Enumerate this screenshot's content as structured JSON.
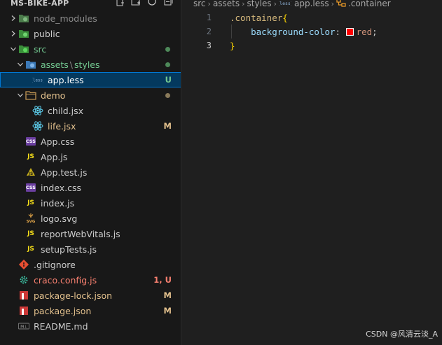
{
  "explorer": {
    "project_title": "MS-BIKE-APP",
    "actions": [
      "new-file-icon",
      "new-folder-icon",
      "refresh-icon",
      "collapse-all-icon"
    ],
    "items": [
      {
        "id": "node_modules",
        "label": "node_modules",
        "icon": "folder-node-icon",
        "depth": 0,
        "chevron": "right",
        "dimmed": true
      },
      {
        "id": "public",
        "label": "public",
        "icon": "folder-public-icon",
        "depth": 0,
        "chevron": "right"
      },
      {
        "id": "src",
        "label": "src",
        "icon": "folder-src-icon",
        "depth": 0,
        "chevron": "down",
        "labelColor": "#73c991",
        "dot": "#4e8a5a"
      },
      {
        "id": "assets",
        "label": "assets",
        "label_sep": "\\",
        "label_extra": "styles",
        "icon": "folder-assets-icon",
        "depth": 1,
        "chevron": "down",
        "labelColor": "#73c991",
        "dot": "#4e8a5a"
      },
      {
        "id": "app-less",
        "label": "app.less",
        "icon": "less-file-icon",
        "depth": 2,
        "selected": true,
        "badge": "U",
        "badgeColor": "#73c991",
        "labelColor": "#ffffff"
      },
      {
        "id": "demo",
        "label": "demo",
        "icon": "folder-icon",
        "depth": 1,
        "chevron": "down",
        "labelColor": "#e2c08d",
        "dot": "#8a7a5a"
      },
      {
        "id": "child-jsx",
        "label": "child.jsx",
        "icon": "react-icon",
        "depth": 2
      },
      {
        "id": "life-jsx",
        "label": "life.jsx",
        "icon": "react-icon",
        "depth": 2,
        "badge": "M",
        "badgeColor": "#e2c08d",
        "labelColor": "#e2c08d"
      },
      {
        "id": "app-css",
        "label": "App.css",
        "icon": "css-file-icon",
        "depth": 1
      },
      {
        "id": "app-js",
        "label": "App.js",
        "icon": "js-file-icon",
        "depth": 1
      },
      {
        "id": "app-test-js",
        "label": "App.test.js",
        "icon": "test-file-icon",
        "depth": 1
      },
      {
        "id": "index-css",
        "label": "index.css",
        "icon": "css-file-icon",
        "depth": 1
      },
      {
        "id": "index-js",
        "label": "index.js",
        "icon": "js-file-icon",
        "depth": 1
      },
      {
        "id": "logo-svg",
        "label": "logo.svg",
        "icon": "svg-file-icon",
        "depth": 1
      },
      {
        "id": "report-web-vitals",
        "label": "reportWebVitals.js",
        "icon": "js-file-icon",
        "depth": 1
      },
      {
        "id": "setup-tests",
        "label": "setupTests.js",
        "icon": "js-file-icon",
        "depth": 1
      },
      {
        "id": "gitignore",
        "label": ".gitignore",
        "icon": "git-icon",
        "depth": 0
      },
      {
        "id": "craco-config",
        "label": "craco.config.js",
        "icon": "gear-icon",
        "depth": 0,
        "badge": "1, U",
        "badgeColor": "#f88070",
        "labelColor": "#f88070"
      },
      {
        "id": "package-lock",
        "label": "package-lock.json",
        "icon": "npm-icon",
        "depth": 0,
        "badge": "M",
        "badgeColor": "#e2c08d",
        "labelColor": "#e2c08d"
      },
      {
        "id": "package-json",
        "label": "package.json",
        "icon": "npm-icon",
        "depth": 0,
        "badge": "M",
        "badgeColor": "#e2c08d",
        "labelColor": "#e2c08d"
      },
      {
        "id": "readme",
        "label": "README.md",
        "icon": "markdown-icon",
        "depth": 0
      }
    ]
  },
  "editor": {
    "breadcrumb": [
      "src",
      "assets",
      "styles",
      "app.less",
      ".container"
    ],
    "lines": [
      {
        "num": "1",
        "tokens": [
          {
            "t": ".container",
            "c": "#d7ba7d"
          },
          {
            "t": "{",
            "c": "#ffd700"
          }
        ]
      },
      {
        "num": "2",
        "tokens": [
          {
            "t": "    ",
            "c": "#cccccc"
          },
          {
            "t": "background-color",
            "c": "#9cdcfe"
          },
          {
            "t": ": ",
            "c": "#cccccc"
          },
          {
            "swatch": "#ff0000"
          },
          {
            "t": "red",
            "c": "#ce9178"
          },
          {
            "t": ";",
            "c": "#cccccc"
          }
        ]
      },
      {
        "num": "3",
        "tokens": [
          {
            "t": "}",
            "c": "#ffd700"
          }
        ],
        "active": true
      }
    ]
  },
  "watermark": "CSDN @风清云淡_A"
}
